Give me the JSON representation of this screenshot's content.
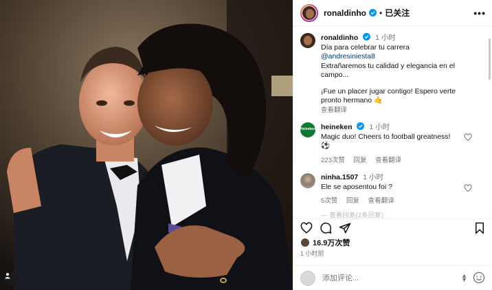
{
  "post": {
    "author": "ronaldinho",
    "follow_state": "已关注",
    "separator": "•",
    "more_icon": "more-horizontal-icon"
  },
  "caption": {
    "author": "ronaldinho",
    "time": "1 小时",
    "line1": "Día para celebrar tu carrera",
    "mention": "@andresiniesta8",
    "line3": "Extrañaremos tu calidad y elegancia en el campo...",
    "line4": "¡Fue un placer jugar contigo! Espero verte pronto hermano",
    "emoji": "🤙",
    "translate": "查看翻译"
  },
  "comments": [
    {
      "author": "heineken",
      "avatar_text": "Heineken",
      "time": "1 小时",
      "text": "Magic duo! Cheers to football greatness! ⚽",
      "likes": "223次赞",
      "reply": "回复",
      "translate": "查看翻译"
    },
    {
      "author": "ninha.1507",
      "time": "1 小时",
      "text": "Ele se aposentou foi ?",
      "likes": "5次赞",
      "reply": "回复",
      "translate": "查看翻译"
    }
  ],
  "more_replies": "— 查看回复(2条回复)",
  "stats": {
    "likes": "16.9万次赞",
    "posted": "1 小时前"
  },
  "composer": {
    "placeholder": "添加评论..."
  },
  "colors": {
    "verified": "#0095f6",
    "link": "#00376b",
    "muted": "#737373"
  }
}
